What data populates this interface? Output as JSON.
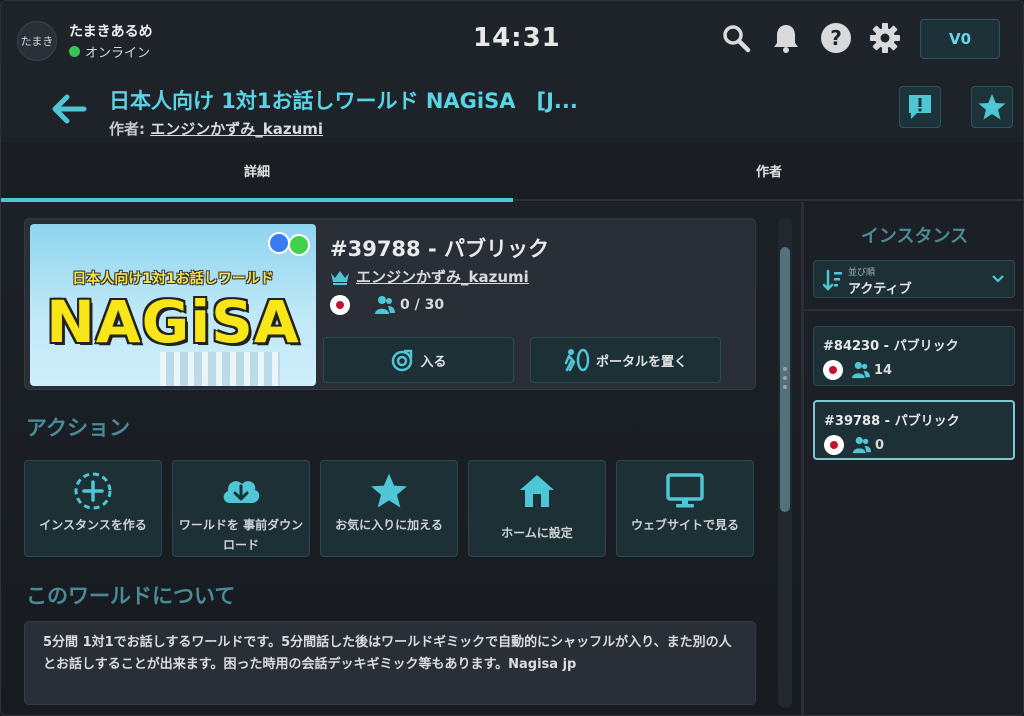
{
  "user": {
    "avatar_text": "たまき",
    "name": "たまきあるめ",
    "status": "オンライン"
  },
  "clock": "14:31",
  "currency_label": "V0",
  "world": {
    "title": "日本人向け 1対1お話しワールド NAGiSA　[J...",
    "author_prefix": "作者: ",
    "author_name": "エンジンかずみ_kazumi"
  },
  "tabs": [
    {
      "label": "詳細"
    },
    {
      "label": "作者"
    }
  ],
  "instance": {
    "title": "#39788 - パブリック",
    "owner": "エンジンかずみ_kazumi",
    "occupancy": "0 / 30",
    "join_label": "入る",
    "portal_label": "ポータルを置く"
  },
  "thumbnail": {
    "subtitle": "日本人向け1対1お話しワールド",
    "logo": "NAGiSA"
  },
  "actions_title": "アクション",
  "actions": [
    {
      "label": "インスタンスを作る",
      "icon": "add-circle-dashed-icon"
    },
    {
      "label": "ワールドを 事前ダウンロード",
      "icon": "cloud-download-icon"
    },
    {
      "label": "お気に入りに加える",
      "icon": "star-icon"
    },
    {
      "label": "ホームに設定",
      "icon": "home-icon"
    },
    {
      "label": "ウェブサイトで見る",
      "icon": "monitor-icon"
    }
  ],
  "about_title": "このワールドについて",
  "description": "5分間 1対1でお話しするワールドです。5分間話した後はワールドギミックで自動的にシャッフルが入り、また別の人とお話しすることが出来ます。困った時用の会話デッキギミック等もあります。Nagisa jp",
  "side": {
    "title": "インスタンス",
    "sort_label": "並び順",
    "sort_value": "アクティブ",
    "instances": [
      {
        "title": "#84230 - パブリック",
        "count": "14"
      },
      {
        "title": "#39788 - パブリック",
        "count": "0"
      }
    ]
  },
  "colors": {
    "accent": "#4ec6d6",
    "title": "#5ad3e4",
    "section": "#4a8a96",
    "button_bg": "#1c3035"
  }
}
